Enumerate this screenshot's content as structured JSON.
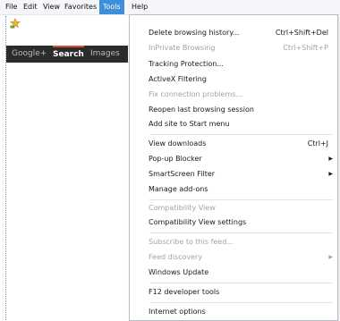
{
  "menubar": {
    "items": [
      "File",
      "Edit",
      "View",
      "Favorites",
      "Tools",
      "Help"
    ],
    "active": "Tools"
  },
  "favorites_bar": {
    "icon": "favorites-star-icon"
  },
  "google_bar": {
    "links": [
      "Google+",
      "Search",
      "Images"
    ],
    "active": "Search"
  },
  "tools_menu": {
    "items": [
      {
        "label": "Delete browsing history...",
        "shortcut": "Ctrl+Shift+Del",
        "disabled": false
      },
      {
        "label": "InPrivate Browsing",
        "shortcut": "Ctrl+Shift+P",
        "disabled": true
      },
      {
        "label": "Tracking Protection...",
        "shortcut": "",
        "disabled": false
      },
      {
        "label": "ActiveX Filtering",
        "shortcut": "",
        "disabled": false
      },
      {
        "label": "Fix connection problems...",
        "shortcut": "",
        "disabled": true
      },
      {
        "label": "Reopen last browsing session",
        "shortcut": "",
        "disabled": false
      },
      {
        "label": "Add site to Start menu",
        "shortcut": "",
        "disabled": false
      },
      {
        "label": "View downloads",
        "shortcut": "Ctrl+J",
        "disabled": false
      },
      {
        "label": "Pop-up Blocker",
        "shortcut": "",
        "disabled": false,
        "submenu": true
      },
      {
        "label": "SmartScreen Filter",
        "shortcut": "",
        "disabled": false,
        "submenu": true
      },
      {
        "label": "Manage add-ons",
        "shortcut": "",
        "disabled": false
      },
      {
        "label": "Compatibility View",
        "shortcut": "",
        "disabled": true
      },
      {
        "label": "Compatibility View settings",
        "shortcut": "",
        "disabled": false
      },
      {
        "label": "Subscribe to this feed...",
        "shortcut": "",
        "disabled": true
      },
      {
        "label": "Feed discovery",
        "shortcut": "",
        "disabled": true,
        "submenu": true
      },
      {
        "label": "Windows Update",
        "shortcut": "",
        "disabled": false
      },
      {
        "label": "F12 developer tools",
        "shortcut": "",
        "disabled": false
      },
      {
        "label": "Internet options",
        "shortcut": "",
        "disabled": false
      }
    ]
  },
  "colors": {
    "menu_highlight": "#3c8fd8",
    "disabled_text": "#a3a3a3",
    "google_bar_bg": "#2b2b2b"
  }
}
